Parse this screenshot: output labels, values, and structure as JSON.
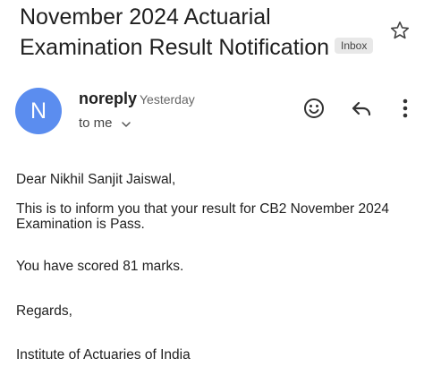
{
  "email": {
    "subject_line1": "November 2024 Actuarial",
    "subject_line2": "Examination Result Notification",
    "label_chip": "Inbox",
    "sender": "noreply",
    "time": "Yesterday",
    "recipient": "to me",
    "avatar_letter": "N",
    "body": {
      "greeting": "Dear Nikhil Sanjit Jaiswal,",
      "para1_line1": "This is to inform you that your result for CB2 November 2024",
      "para1_line2": "Examination is Pass.",
      "para2": "You have scored 81 marks.",
      "closing": "Regards,",
      "signature": "Institute of Actuaries of India"
    }
  },
  "icons": {
    "star": "star-outline-icon",
    "emoji": "emoji-reaction-icon",
    "reply": "reply-icon",
    "more": "more-vert-icon",
    "chevron": "chevron-down-icon"
  },
  "colors": {
    "avatar_bg": "#5b8def",
    "chip_bg": "#e8e8e8",
    "text": "#1f1f1f"
  }
}
